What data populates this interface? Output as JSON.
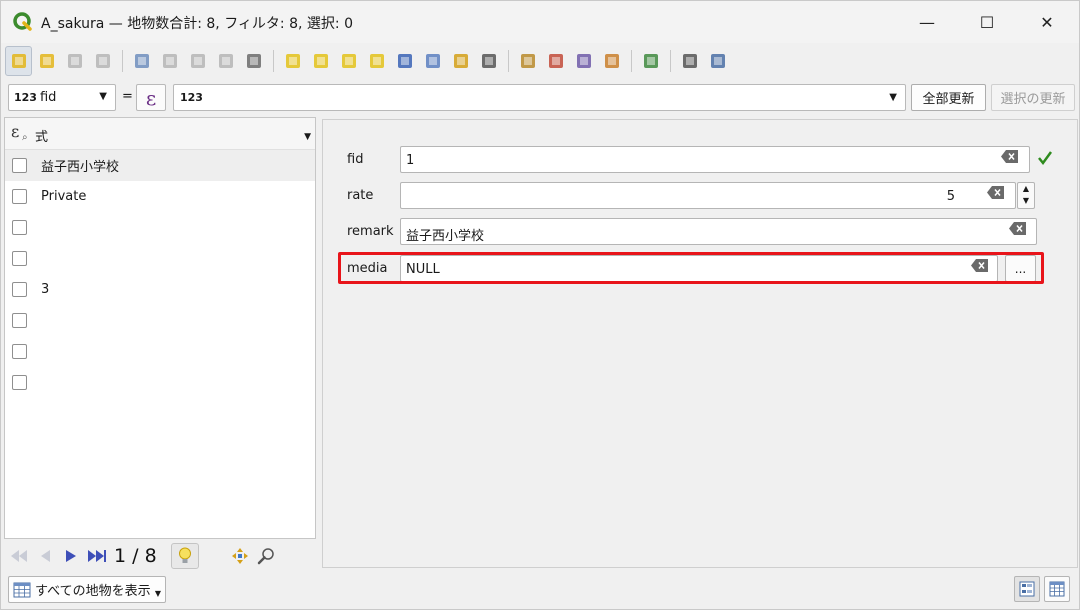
{
  "window": {
    "title": "A_sakura — 地物数合計: 8, フィルタ: 8, 選択: 0",
    "minimize": "—",
    "maximize": "☐",
    "close": "✕"
  },
  "toolbar": {
    "buttons": [
      {
        "icon": "pencil-edit-icon",
        "active": true
      },
      {
        "icon": "multi-edit-icon"
      },
      {
        "icon": "save-edits-icon"
      },
      {
        "icon": "reload-icon"
      },
      {
        "sep": true
      },
      {
        "icon": "add-feature-icon"
      },
      {
        "icon": "delete-feature-icon"
      },
      {
        "icon": "cut-icon"
      },
      {
        "icon": "copy-icon"
      },
      {
        "icon": "paste-icon"
      },
      {
        "sep": true
      },
      {
        "icon": "select-by-expression-icon"
      },
      {
        "icon": "select-all-icon"
      },
      {
        "icon": "invert-selection-icon"
      },
      {
        "icon": "deselect-icon"
      },
      {
        "icon": "filter-icon"
      },
      {
        "icon": "move-selection-top-icon"
      },
      {
        "icon": "pan-to-selection-icon"
      },
      {
        "icon": "zoom-to-selection-icon"
      },
      {
        "sep": true
      },
      {
        "icon": "new-field-icon"
      },
      {
        "icon": "delete-field-icon"
      },
      {
        "icon": "field-calculator-icon"
      },
      {
        "icon": "conditional-format-icon"
      },
      {
        "sep": true
      },
      {
        "icon": "actions-icon"
      },
      {
        "sep": true
      },
      {
        "icon": "dock-icon"
      },
      {
        "icon": "organize-columns-icon"
      }
    ]
  },
  "filter": {
    "field_type": "123",
    "field_name": "fid",
    "operator": "=",
    "epsilon": "ε",
    "value": "123",
    "update_all_label": "全部更新",
    "update_selection_label": "選択の更新"
  },
  "list": {
    "header_label": "式",
    "items": [
      {
        "label": "益子西小学校",
        "selected": true
      },
      {
        "label": "Private"
      },
      {
        "label": ""
      },
      {
        "label": ""
      },
      {
        "label": "3"
      },
      {
        "label": ""
      },
      {
        "label": ""
      },
      {
        "label": ""
      }
    ]
  },
  "nav": {
    "count": "1 / 8"
  },
  "form": {
    "fid": {
      "label": "fid",
      "value": "1"
    },
    "rate": {
      "label": "rate",
      "value": "5"
    },
    "remark": {
      "label": "remark",
      "value": "益子西小学校"
    },
    "media": {
      "label": "media",
      "value": "NULL",
      "more": "..."
    }
  },
  "status": {
    "show_all_label": "すべての地物を表示"
  },
  "colors": {
    "highlight": "#e8141a",
    "check": "#2e8b1e",
    "epsilon": "#6b2f86"
  }
}
